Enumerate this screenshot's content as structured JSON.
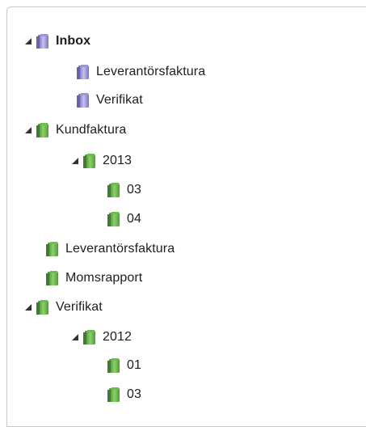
{
  "tree": {
    "inbox": {
      "label": "Inbox",
      "children": [
        "Leverantörsfaktura",
        "Verifikat"
      ]
    },
    "kundfaktura": {
      "label": "Kundfaktura",
      "year": "2013",
      "months": [
        "03",
        "04"
      ]
    },
    "leverantorsfaktura": {
      "label": "Leverantörsfaktura"
    },
    "momsrapport": {
      "label": "Momsrapport"
    },
    "verifikat": {
      "label": "Verifikat",
      "year": "2012",
      "months": [
        "01",
        "03"
      ]
    }
  },
  "icons": {
    "expanded_toggle": "triangle-expanded-icon",
    "inbox_folder": "folder-purple-icon",
    "folder": "folder-green-icon"
  },
  "colors": {
    "purple_folder": "#8e86c8",
    "green_folder": "#58a742",
    "text": "#202020",
    "border": "#c8c8c8"
  }
}
